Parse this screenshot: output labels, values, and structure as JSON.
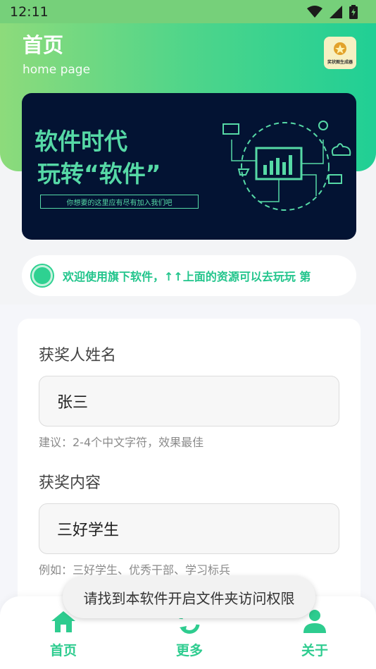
{
  "status_bar": {
    "time": "12:11",
    "icons": [
      "wifi-icon",
      "signal-icon",
      "battery-icon"
    ]
  },
  "header": {
    "title": "首页",
    "subtitle": "home page",
    "logo_caption": "奖状图生成器"
  },
  "banner": {
    "line1": "软件时代",
    "line2": "玩转“软件”",
    "sub": "你想要的这里应有尽有加入我们吧"
  },
  "notice": {
    "text": "欢迎使用旗下软件，↑↑上面的资源可以去玩玩 第"
  },
  "form": {
    "name_label": "获奖人姓名",
    "name_value": "张三",
    "name_hint": "建议：2-4个中文字符，效果最佳",
    "content_label": "获奖内容",
    "content_value": "三好学生",
    "content_hint": "例如：三好学生、优秀干部、学习标兵"
  },
  "nav": {
    "items": [
      {
        "label": "首页",
        "icon": "home-icon"
      },
      {
        "label": "更多",
        "icon": "refresh-icon"
      },
      {
        "label": "关于",
        "icon": "person-icon"
      }
    ]
  },
  "toast": {
    "text": "请找到本软件开启文件夹访问权限"
  },
  "colors": {
    "accent": "#2ecc8f",
    "banner_bg": "#031333",
    "banner_text": "#56d9a6"
  }
}
